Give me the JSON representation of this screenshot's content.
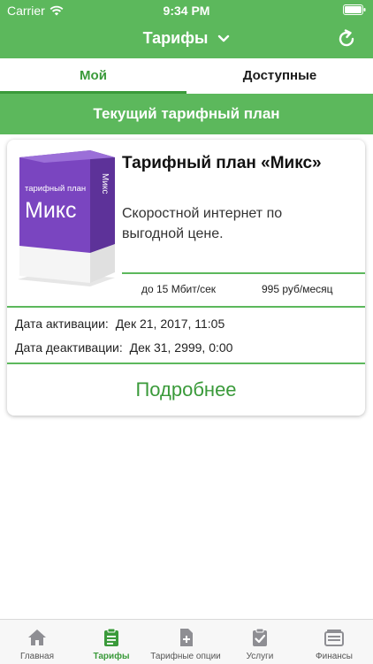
{
  "status_bar": {
    "carrier": "Carrier",
    "time": "9:34 PM",
    "wifi_icon": "wifi-icon",
    "battery_icon": "battery-icon"
  },
  "nav": {
    "title": "Тарифы",
    "dropdown_icon": "chevron-down-icon",
    "refresh_icon": "refresh-icon"
  },
  "tabs": {
    "mine": "Мой",
    "available": "Доступные",
    "active": "mine"
  },
  "section_title": "Текущий тарифный план",
  "plan": {
    "name": "Тарифный план «Микс»",
    "description": "Скоростной интернет по выгодной цене.",
    "speed": "до 15 Мбит/сек",
    "price": "995 руб/месяц",
    "box_label_top": "тарифный план",
    "box_label_main": "Микс",
    "box_side_label": "Микс",
    "activation_label": "Дата активации:",
    "activation_value": "Дек 21, 2017, 11:05",
    "deactivation_label": "Дата деактивации:",
    "deactivation_value": "Дек 31, 2999, 0:00",
    "more_label": "Подробнее"
  },
  "tabbar": {
    "items": [
      {
        "label": "Главная",
        "icon": "home-icon"
      },
      {
        "label": "Тарифы",
        "icon": "clipboard-icon"
      },
      {
        "label": "Тарифные опции",
        "icon": "sim-plus-icon"
      },
      {
        "label": "Услуги",
        "icon": "clipboard-check-icon"
      },
      {
        "label": "Финансы",
        "icon": "wallet-icon"
      }
    ],
    "active_index": 1
  },
  "colors": {
    "brand_green": "#5cb85c",
    "accent_green": "#3a9a3a",
    "box_purple": "#7a45c0"
  }
}
